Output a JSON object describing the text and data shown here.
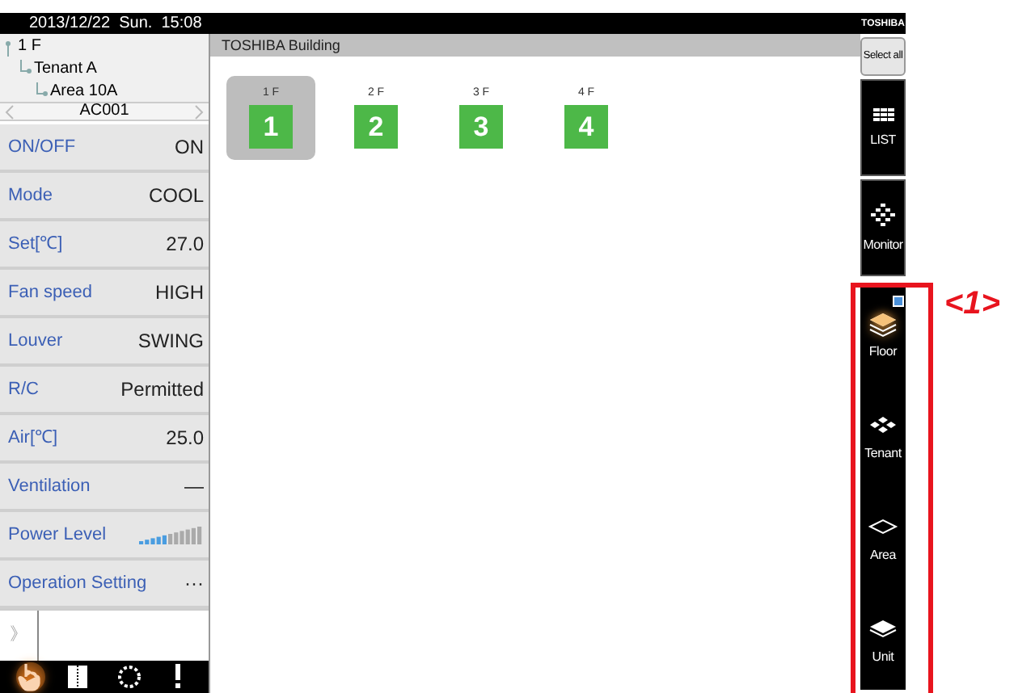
{
  "status_bar": {
    "datetime": "2013/12/22  Sun.  15:08",
    "brand": "TOSHIBA"
  },
  "tree": [
    {
      "label": "1 F",
      "children": [
        {
          "label": "Tenant A",
          "children": [
            {
              "label": "Area 10A"
            }
          ]
        }
      ]
    }
  ],
  "unit_nav": {
    "label": "AC001"
  },
  "settings": [
    {
      "kind": "value",
      "label": "ON/OFF",
      "value": "ON"
    },
    {
      "kind": "value",
      "label": "Mode",
      "value": "COOL"
    },
    {
      "kind": "value",
      "label": "Set[℃]",
      "value": "27.0"
    },
    {
      "kind": "value",
      "label": "Fan speed",
      "value": "HIGH"
    },
    {
      "kind": "value",
      "label": "Louver",
      "value": "SWING"
    },
    {
      "kind": "value",
      "label": "R/C",
      "value": "Permitted"
    },
    {
      "kind": "value",
      "label": "Air[℃]",
      "value": "25.0"
    },
    {
      "kind": "value",
      "label": "Ventilation",
      "value": "—"
    },
    {
      "kind": "level",
      "label": "Power Level",
      "level": 0.45
    },
    {
      "kind": "value",
      "label": "Operation Setting",
      "value": "···"
    }
  ],
  "expand": "》",
  "bottom_toolbar": [
    {
      "kind": "hand",
      "selected": true
    },
    {
      "kind": "book",
      "selected": false
    },
    {
      "kind": "circle",
      "selected": false
    },
    {
      "kind": "alert",
      "selected": false
    }
  ],
  "building": {
    "title": "TOSHIBA Building",
    "floors": [
      {
        "label": "1 F",
        "number": "1",
        "selected": true
      },
      {
        "label": "2 F",
        "number": "2",
        "selected": false
      },
      {
        "label": "3 F",
        "number": "3",
        "selected": false
      },
      {
        "label": "4 F",
        "number": "4",
        "selected": false
      }
    ]
  },
  "right_panel": {
    "select_all": "Select all",
    "views": [
      {
        "label": "LIST",
        "kind": "list"
      },
      {
        "label": "Monitor",
        "kind": "monitor"
      }
    ],
    "levels": [
      {
        "label": "Floor",
        "kind": "floor",
        "selected": true,
        "checked": true
      },
      {
        "label": "Tenant",
        "kind": "tenant",
        "selected": false,
        "checked": false
      },
      {
        "label": "Area",
        "kind": "area",
        "selected": false,
        "checked": false
      },
      {
        "label": "Unit",
        "kind": "unit",
        "selected": false,
        "checked": false
      }
    ]
  },
  "annotation": {
    "label": "<1>"
  }
}
